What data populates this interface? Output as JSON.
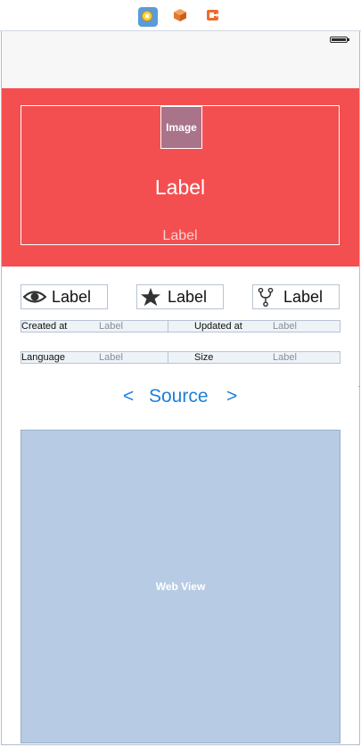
{
  "dock": {
    "icons": [
      "view-controller-icon",
      "first-responder-icon",
      "exit-icon"
    ]
  },
  "header": {
    "image_placeholder": "Image",
    "title": "Label",
    "subtitle": "Label",
    "background_color": "#f44f50"
  },
  "stats": [
    {
      "icon": "eye-icon",
      "label": "Label"
    },
    {
      "icon": "star-icon",
      "label": "Label"
    },
    {
      "icon": "fork-icon",
      "label": "Label"
    }
  ],
  "info": {
    "created_at_key": "Created at",
    "created_at_value": "Label",
    "updated_at_key": "Updated at",
    "updated_at_value": "Label",
    "language_key": "Language",
    "language_value": "Label",
    "size_key": "Size",
    "size_value": "Label"
  },
  "source": {
    "prev": "<",
    "title": "Source",
    "next": ">",
    "accent_color": "#1c7fdc"
  },
  "web_view": {
    "placeholder": "Web View",
    "background_color": "#b7cce4"
  }
}
